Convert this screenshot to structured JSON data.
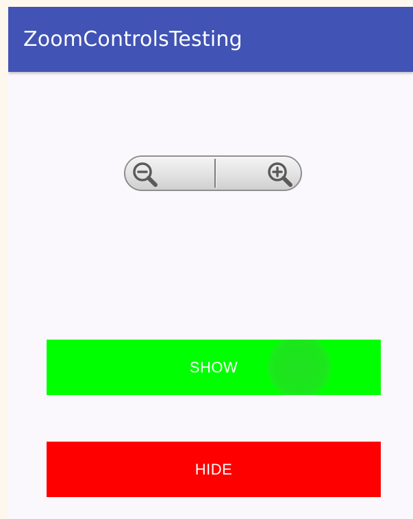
{
  "app_bar": {
    "title": "ZoomControlsTesting",
    "color": "#4153b4"
  },
  "zoom_controls": {
    "zoom_out_icon": "zoom-out-icon",
    "zoom_in_icon": "zoom-in-icon"
  },
  "buttons": {
    "show_label": "SHOW",
    "show_color": "#00ff00",
    "hide_label": "HIDE",
    "hide_color": "#ff0000"
  }
}
